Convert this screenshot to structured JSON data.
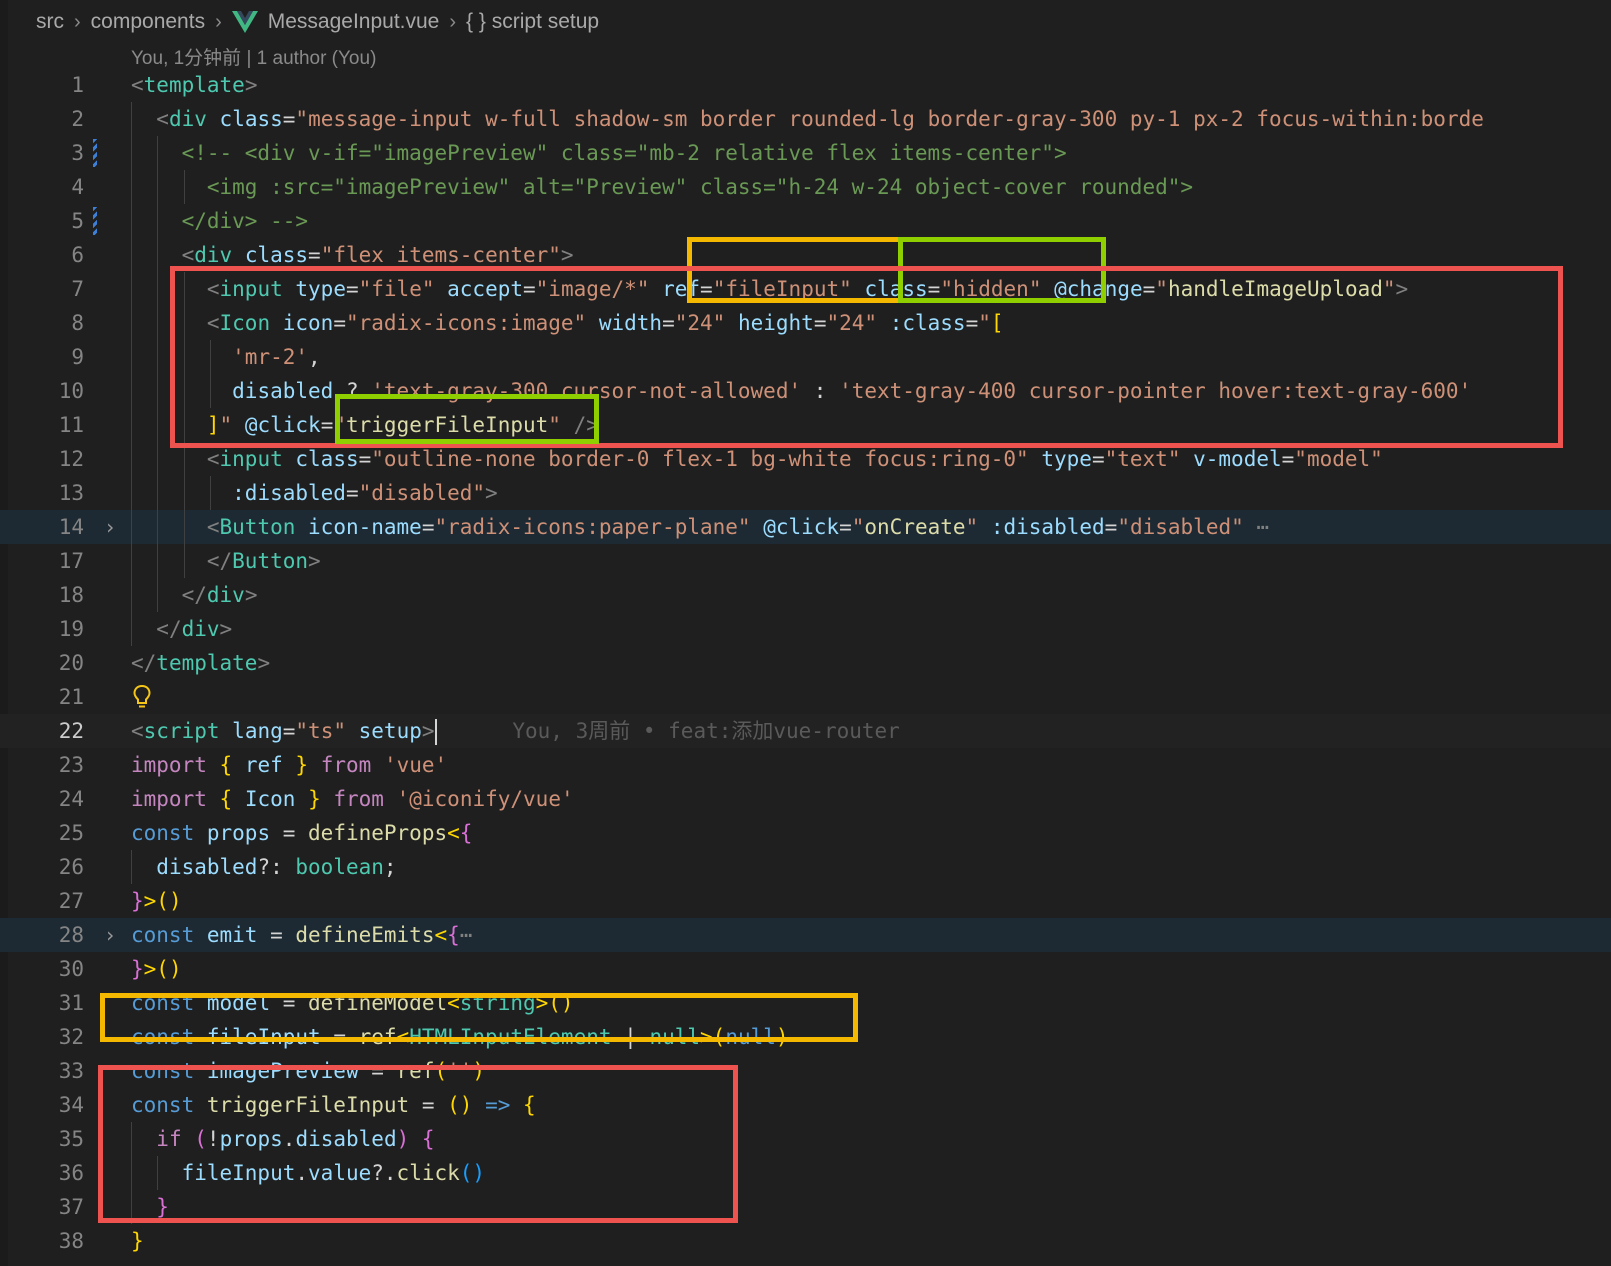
{
  "breadcrumb": {
    "items": [
      "src",
      "components",
      "MessageInput.vue",
      "{ } script setup"
    ]
  },
  "codelens": "You, 1分钟前 | 1 author (You)",
  "blame": "You, 3周前 • feat:添加vue-router",
  "annotation_colors": {
    "red": "#ef5350",
    "yellow": "#f5b800",
    "green": "#8fcf00"
  },
  "editor": {
    "lines": [
      {
        "n": "1",
        "segs": [
          [
            "p",
            "<"
          ],
          [
            "t",
            "template"
          ],
          [
            "p",
            ">"
          ]
        ]
      },
      {
        "n": "2",
        "segs": [
          [
            "w",
            "  "
          ],
          [
            "p",
            "<"
          ],
          [
            "t",
            "div"
          ],
          [
            "w",
            " "
          ],
          [
            "a",
            "class"
          ],
          [
            "w",
            "="
          ],
          [
            "s",
            "\"message-input w-full shadow-sm border rounded-lg border-gray-300 py-1 px-2 focus-within:borde"
          ]
        ]
      },
      {
        "n": "3",
        "segs": [
          [
            "w",
            "    "
          ],
          [
            "cm",
            "<!-- <div v-if=\"imagePreview\" class=\"mb-2 relative flex items-center\">"
          ]
        ]
      },
      {
        "n": "4",
        "segs": [
          [
            "w",
            "      "
          ],
          [
            "cm",
            "<img :src=\"imagePreview\" alt=\"Preview\" class=\"h-24 w-24 object-cover rounded\">"
          ]
        ]
      },
      {
        "n": "5",
        "segs": [
          [
            "w",
            "    "
          ],
          [
            "cm",
            "</div> -->"
          ]
        ]
      },
      {
        "n": "6",
        "segs": [
          [
            "w",
            "    "
          ],
          [
            "p",
            "<"
          ],
          [
            "t",
            "div"
          ],
          [
            "w",
            " "
          ],
          [
            "a",
            "class"
          ],
          [
            "w",
            "="
          ],
          [
            "s",
            "\"flex items-center\""
          ],
          [
            "p",
            ">"
          ]
        ]
      },
      {
        "n": "7",
        "segs": [
          [
            "w",
            "      "
          ],
          [
            "p",
            "<"
          ],
          [
            "t",
            "input"
          ],
          [
            "w",
            " "
          ],
          [
            "a",
            "type"
          ],
          [
            "w",
            "="
          ],
          [
            "s",
            "\"file\""
          ],
          [
            "w",
            " "
          ],
          [
            "a",
            "accept"
          ],
          [
            "w",
            "="
          ],
          [
            "s",
            "\"image/*\""
          ],
          [
            "w",
            " "
          ],
          [
            "a",
            "ref"
          ],
          [
            "w",
            "="
          ],
          [
            "s",
            "\"fileInput\""
          ],
          [
            "w",
            " "
          ],
          [
            "a",
            "class"
          ],
          [
            "w",
            "="
          ],
          [
            "s",
            "\"hidden\""
          ],
          [
            "w",
            " "
          ],
          [
            "a",
            "@change"
          ],
          [
            "w",
            "="
          ],
          [
            "s",
            "\""
          ],
          [
            "f",
            "handleImageUpload"
          ],
          [
            "s",
            "\""
          ],
          [
            "p",
            ">"
          ]
        ]
      },
      {
        "n": "8",
        "segs": [
          [
            "w",
            "      "
          ],
          [
            "p",
            "<"
          ],
          [
            "t",
            "Icon"
          ],
          [
            "w",
            " "
          ],
          [
            "a",
            "icon"
          ],
          [
            "w",
            "="
          ],
          [
            "s",
            "\"radix-icons:image\""
          ],
          [
            "w",
            " "
          ],
          [
            "a",
            "width"
          ],
          [
            "w",
            "="
          ],
          [
            "s",
            "\"24\""
          ],
          [
            "w",
            " "
          ],
          [
            "a",
            "height"
          ],
          [
            "w",
            "="
          ],
          [
            "s",
            "\"24\""
          ],
          [
            "w",
            " "
          ],
          [
            "a",
            ":class"
          ],
          [
            "w",
            "="
          ],
          [
            "s",
            "\""
          ],
          [
            "y",
            "["
          ]
        ]
      },
      {
        "n": "9",
        "segs": [
          [
            "w",
            "        "
          ],
          [
            "s",
            "'mr-2'"
          ],
          [
            "w",
            ","
          ]
        ]
      },
      {
        "n": "10",
        "segs": [
          [
            "w",
            "        "
          ],
          [
            "a",
            "disabled"
          ],
          [
            "w",
            " ? "
          ],
          [
            "s",
            "'text-gray-300 cursor-not-allowed'"
          ],
          [
            "w",
            " : "
          ],
          [
            "s",
            "'text-gray-400 cursor-pointer hover:text-gray-600'"
          ]
        ]
      },
      {
        "n": "11",
        "segs": [
          [
            "w",
            "      "
          ],
          [
            "y",
            "]"
          ],
          [
            "s",
            "\""
          ],
          [
            "w",
            " "
          ],
          [
            "a",
            "@click"
          ],
          [
            "w",
            "="
          ],
          [
            "s",
            "\""
          ],
          [
            "f",
            "triggerFileInput"
          ],
          [
            "s",
            "\""
          ],
          [
            "w",
            " "
          ],
          [
            "p",
            "/>"
          ]
        ]
      },
      {
        "n": "12",
        "segs": [
          [
            "w",
            "      "
          ],
          [
            "p",
            "<"
          ],
          [
            "t",
            "input"
          ],
          [
            "w",
            " "
          ],
          [
            "a",
            "class"
          ],
          [
            "w",
            "="
          ],
          [
            "s",
            "\"outline-none border-0 flex-1 bg-white focus:ring-0\""
          ],
          [
            "w",
            " "
          ],
          [
            "a",
            "type"
          ],
          [
            "w",
            "="
          ],
          [
            "s",
            "\"text\""
          ],
          [
            "w",
            " "
          ],
          [
            "a",
            "v-model"
          ],
          [
            "w",
            "="
          ],
          [
            "s",
            "\"model\""
          ]
        ]
      },
      {
        "n": "13",
        "segs": [
          [
            "w",
            "        "
          ],
          [
            "a",
            ":disabled"
          ],
          [
            "w",
            "="
          ],
          [
            "s",
            "\"disabled\""
          ],
          [
            "p",
            ">"
          ]
        ]
      },
      {
        "n": "14",
        "segs": [
          [
            "w",
            "      "
          ],
          [
            "p",
            "<"
          ],
          [
            "t",
            "Button"
          ],
          [
            "w",
            " "
          ],
          [
            "a",
            "icon-name"
          ],
          [
            "w",
            "="
          ],
          [
            "s",
            "\"radix-icons:paper-plane\""
          ],
          [
            "w",
            " "
          ],
          [
            "a",
            "@click"
          ],
          [
            "w",
            "="
          ],
          [
            "s",
            "\""
          ],
          [
            "f",
            "onCreate"
          ],
          [
            "s",
            "\""
          ],
          [
            "w",
            " "
          ],
          [
            "a",
            ":disabled"
          ],
          [
            "w",
            "="
          ],
          [
            "s",
            "\"disabled\""
          ],
          [
            "p",
            " ⋯"
          ]
        ]
      },
      {
        "n": "17",
        "segs": [
          [
            "w",
            "      "
          ],
          [
            "p",
            "</"
          ],
          [
            "t",
            "Button"
          ],
          [
            "p",
            ">"
          ]
        ]
      },
      {
        "n": "18",
        "segs": [
          [
            "w",
            "    "
          ],
          [
            "p",
            "</"
          ],
          [
            "t",
            "div"
          ],
          [
            "p",
            ">"
          ]
        ]
      },
      {
        "n": "19",
        "segs": [
          [
            "w",
            "  "
          ],
          [
            "p",
            "</"
          ],
          [
            "t",
            "div"
          ],
          [
            "p",
            ">"
          ]
        ]
      },
      {
        "n": "20",
        "segs": [
          [
            "p",
            "</"
          ],
          [
            "t",
            "template"
          ],
          [
            "p",
            ">"
          ]
        ]
      },
      {
        "n": "21",
        "segs": []
      },
      {
        "n": "22",
        "segs": [
          [
            "p",
            "<"
          ],
          [
            "t",
            "script"
          ],
          [
            "w",
            " "
          ],
          [
            "a",
            "lang"
          ],
          [
            "w",
            "="
          ],
          [
            "s",
            "\"ts\""
          ],
          [
            "w",
            " "
          ],
          [
            "a",
            "setup"
          ],
          [
            "p",
            ">"
          ]
        ]
      },
      {
        "n": "23",
        "segs": [
          [
            "k",
            "import"
          ],
          [
            "w",
            " "
          ],
          [
            "y",
            "{"
          ],
          [
            "w",
            " "
          ],
          [
            "a",
            "ref"
          ],
          [
            "w",
            " "
          ],
          [
            "y",
            "}"
          ],
          [
            "w",
            " "
          ],
          [
            "k",
            "from"
          ],
          [
            "w",
            " "
          ],
          [
            "s",
            "'vue'"
          ]
        ]
      },
      {
        "n": "24",
        "segs": [
          [
            "k",
            "import"
          ],
          [
            "w",
            " "
          ],
          [
            "y",
            "{"
          ],
          [
            "w",
            " "
          ],
          [
            "a",
            "Icon"
          ],
          [
            "w",
            " "
          ],
          [
            "y",
            "}"
          ],
          [
            "w",
            " "
          ],
          [
            "k",
            "from"
          ],
          [
            "w",
            " "
          ],
          [
            "s",
            "'@iconify/vue'"
          ]
        ]
      },
      {
        "n": "25",
        "segs": [
          [
            "kb",
            "const"
          ],
          [
            "w",
            " "
          ],
          [
            "a",
            "props"
          ],
          [
            "w",
            " = "
          ],
          [
            "f",
            "defineProps"
          ],
          [
            "y",
            "<"
          ],
          [
            "m",
            "{"
          ]
        ]
      },
      {
        "n": "26",
        "segs": [
          [
            "w",
            "  "
          ],
          [
            "a",
            "disabled"
          ],
          [
            "w",
            "?: "
          ],
          [
            "t",
            "boolean"
          ],
          [
            "w",
            ";"
          ]
        ]
      },
      {
        "n": "27",
        "segs": [
          [
            "m",
            "}"
          ],
          [
            "y",
            ">()"
          ]
        ]
      },
      {
        "n": "28",
        "segs": [
          [
            "kb",
            "const"
          ],
          [
            "w",
            " "
          ],
          [
            "a",
            "emit"
          ],
          [
            "w",
            " = "
          ],
          [
            "f",
            "defineEmits"
          ],
          [
            "y",
            "<"
          ],
          [
            "m",
            "{"
          ],
          [
            "p",
            "⋯"
          ]
        ]
      },
      {
        "n": "30",
        "segs": [
          [
            "m",
            "}"
          ],
          [
            "y",
            ">()"
          ]
        ]
      },
      {
        "n": "31",
        "segs": [
          [
            "kb",
            "const"
          ],
          [
            "w",
            " "
          ],
          [
            "a",
            "model"
          ],
          [
            "w",
            " = "
          ],
          [
            "f",
            "defineModel"
          ],
          [
            "y",
            "<"
          ],
          [
            "t",
            "string"
          ],
          [
            "y",
            ">()"
          ]
        ]
      },
      {
        "n": "32",
        "segs": [
          [
            "kb",
            "const"
          ],
          [
            "w",
            " "
          ],
          [
            "a",
            "fileInput"
          ],
          [
            "w",
            " = "
          ],
          [
            "f",
            "ref"
          ],
          [
            "y",
            "<"
          ],
          [
            "t",
            "HTMLInputElement"
          ],
          [
            "w",
            " | "
          ],
          [
            "t",
            "null"
          ],
          [
            "y",
            ">("
          ],
          [
            "kb",
            "null"
          ],
          [
            "y",
            ")"
          ]
        ]
      },
      {
        "n": "33",
        "segs": [
          [
            "kb",
            "const"
          ],
          [
            "w",
            " "
          ],
          [
            "a",
            "imagePreview"
          ],
          [
            "w",
            " = "
          ],
          [
            "f",
            "ref"
          ],
          [
            "y",
            "("
          ],
          [
            "s",
            "''"
          ],
          [
            "y",
            ")"
          ]
        ]
      },
      {
        "n": "34",
        "segs": [
          [
            "kb",
            "const"
          ],
          [
            "w",
            " "
          ],
          [
            "f",
            "triggerFileInput"
          ],
          [
            "w",
            " = "
          ],
          [
            "y",
            "()"
          ],
          [
            "w",
            " "
          ],
          [
            "kb",
            "=>"
          ],
          [
            "w",
            " "
          ],
          [
            "y",
            "{"
          ]
        ]
      },
      {
        "n": "35",
        "segs": [
          [
            "w",
            "  "
          ],
          [
            "k",
            "if"
          ],
          [
            "w",
            " "
          ],
          [
            "m",
            "("
          ],
          [
            "w",
            "!"
          ],
          [
            "a",
            "props"
          ],
          [
            "w",
            "."
          ],
          [
            "a",
            "disabled"
          ],
          [
            "m",
            ")"
          ],
          [
            "w",
            " "
          ],
          [
            "m",
            "{"
          ]
        ]
      },
      {
        "n": "36",
        "segs": [
          [
            "w",
            "    "
          ],
          [
            "a",
            "fileInput"
          ],
          [
            "w",
            "."
          ],
          [
            "a",
            "value"
          ],
          [
            "w",
            "?."
          ],
          [
            "f",
            "click"
          ],
          [
            "bl",
            "()"
          ]
        ]
      },
      {
        "n": "37",
        "segs": [
          [
            "w",
            "  "
          ],
          [
            "m",
            "}"
          ]
        ]
      },
      {
        "n": "38",
        "segs": [
          [
            "y",
            "}"
          ]
        ]
      }
    ]
  }
}
